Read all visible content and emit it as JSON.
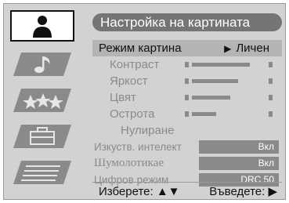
{
  "title": "Настройка на картината",
  "menu": [
    {
      "label": "Режим картина",
      "value": "Личен",
      "value_icon": "▶",
      "selected": true,
      "kind": "value"
    },
    {
      "label": "Контраст",
      "kind": "slider",
      "level": 0.9
    },
    {
      "label": "Яркост",
      "kind": "slider",
      "level": 0.72
    },
    {
      "label": "Цвят",
      "kind": "slider",
      "level": 0.6
    },
    {
      "label": "Острота",
      "kind": "slider",
      "level": 0.38
    },
    {
      "label": "Нулиране",
      "kind": "action"
    },
    {
      "label": "Изкуств. интелект",
      "kind": "box",
      "value": "Вкл"
    },
    {
      "label": "Шумолотикае",
      "kind": "box",
      "value": "Вкл"
    },
    {
      "label": "Цифров режим",
      "kind": "box",
      "value": "DRC 50"
    }
  ],
  "footer": {
    "select": "Изберете: ▲▼",
    "enter": "Въведете: ▶"
  },
  "sidebar_icons": [
    "person-icon",
    "music-note-icon",
    "stars-icon",
    "toolbox-icon",
    "document-list-icon"
  ],
  "colors": {
    "panel": "#d2d2d2",
    "title_bg": "#757575",
    "highlight": "#b4b4b4",
    "dim_text": "#8a8a8a"
  }
}
